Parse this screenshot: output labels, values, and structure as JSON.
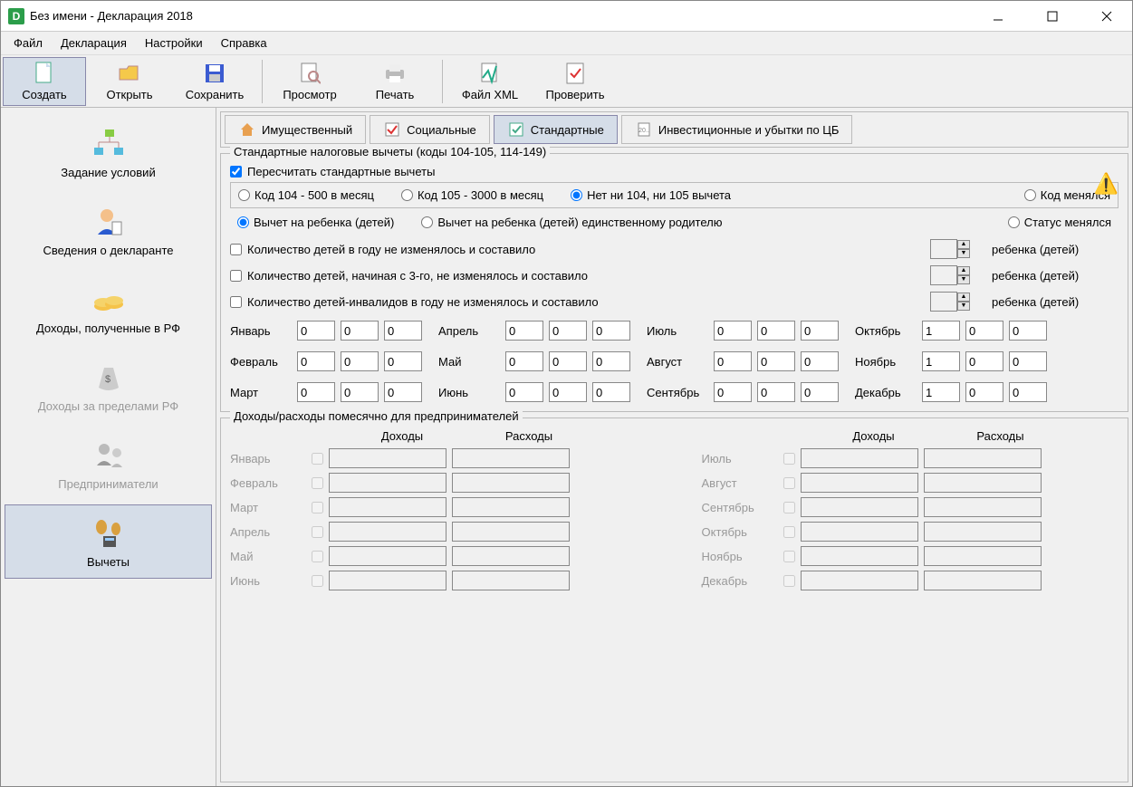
{
  "window": {
    "title": "Без имени - Декларация 2018",
    "icon_letter": "D"
  },
  "menu": {
    "file": "Файл",
    "decl": "Декларация",
    "settings": "Настройки",
    "help": "Справка"
  },
  "toolbar": {
    "create": "Создать",
    "open": "Открыть",
    "save": "Сохранить",
    "view": "Просмотр",
    "print": "Печать",
    "xml": "Файл XML",
    "check": "Проверить"
  },
  "sidebar": {
    "conditions": "Задание условий",
    "declarant": "Сведения о декларанте",
    "income_rf": "Доходы, полученные в РФ",
    "income_abroad": "Доходы за пределами РФ",
    "entrepreneurs": "Предприниматели",
    "deductions": "Вычеты"
  },
  "tabs": {
    "property": "Имущественный",
    "social": "Социальные",
    "standard": "Стандартные",
    "invest": "Инвестиционные и убытки по ЦБ"
  },
  "std": {
    "legend": "Стандартные налоговые вычеты (коды 104-105, 114-149)",
    "recalc": "Пересчитать стандартные вычеты",
    "r104": "Код 104 - 500 в месяц",
    "r105": "Код 105 - 3000 в месяц",
    "rnone": "Нет ни 104, ни 105 вычета",
    "rchange": "Код менялся",
    "rchild": "Вычет на ребенка (детей)",
    "rsingle": "Вычет на ребенка (детей) единственному родителю",
    "rstatus": "Статус менялся",
    "chk1": "Количество детей в году не изменялось и составило",
    "chk2": "Количество детей, начиная с 3-го, не изменялось и составило",
    "chk3": "Количество детей-инвалидов в году не изменялось и составило",
    "unit": "ребенка (детей)"
  },
  "months": {
    "jan": "Январь",
    "feb": "Февраль",
    "mar": "Март",
    "apr": "Апрель",
    "may": "Май",
    "jun": "Июнь",
    "jul": "Июль",
    "aug": "Август",
    "sep": "Сентябрь",
    "oct": "Октябрь",
    "nov": "Ноябрь",
    "dec": "Декабрь"
  },
  "month_vals": {
    "jan": [
      "0",
      "0",
      "0"
    ],
    "feb": [
      "0",
      "0",
      "0"
    ],
    "mar": [
      "0",
      "0",
      "0"
    ],
    "apr": [
      "0",
      "0",
      "0"
    ],
    "may": [
      "0",
      "0",
      "0"
    ],
    "jun": [
      "0",
      "0",
      "0"
    ],
    "jul": [
      "0",
      "0",
      "0"
    ],
    "aug": [
      "0",
      "0",
      "0"
    ],
    "sep": [
      "0",
      "0",
      "0"
    ],
    "oct": [
      "1",
      "0",
      "0"
    ],
    "nov": [
      "1",
      "0",
      "0"
    ],
    "dec": [
      "1",
      "0",
      "0"
    ]
  },
  "ent": {
    "legend": "Доходы/расходы помесячно для предпринимателей",
    "income": "Доходы",
    "expense": "Расходы"
  }
}
